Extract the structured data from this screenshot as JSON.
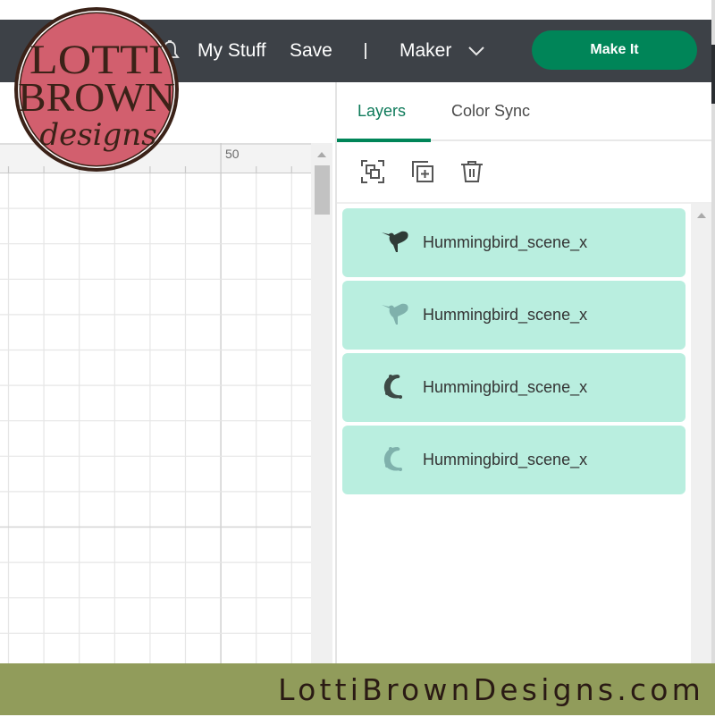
{
  "header": {
    "my_stuff_label": "My Stuff",
    "save_label": "Save",
    "separator": "|",
    "machine_label": "Maker",
    "make_it_label": "Make It"
  },
  "canvas": {
    "ruler_label": "50"
  },
  "panel": {
    "tabs": [
      {
        "label": "Layers",
        "active": true
      },
      {
        "label": "Color Sync",
        "active": false
      }
    ],
    "toolbar": [
      "group-icon",
      "duplicate-icon",
      "delete-icon"
    ],
    "layers": [
      {
        "name": "Hummingbird_scene_x",
        "thumbnail": "hummingbird-dark"
      },
      {
        "name": "Hummingbird_scene_x",
        "thumbnail": "hummingbird-light"
      },
      {
        "name": "Hummingbird_scene_x",
        "thumbnail": "floral-crescent-dark"
      },
      {
        "name": "Hummingbird_scene_x",
        "thumbnail": "floral-crescent-light"
      }
    ]
  },
  "logo": {
    "line1": "LOTTI",
    "line2": "BROWN",
    "line3": "designs"
  },
  "footer": {
    "website": "LottiBrownDesigns.com"
  },
  "colors": {
    "header_bg": "#3d4147",
    "accent_green": "#008558",
    "layer_bg": "#b9eedf",
    "logo_fill": "#d25f6e",
    "logo_ink": "#3b2218",
    "footer_bg": "#919c5b"
  }
}
